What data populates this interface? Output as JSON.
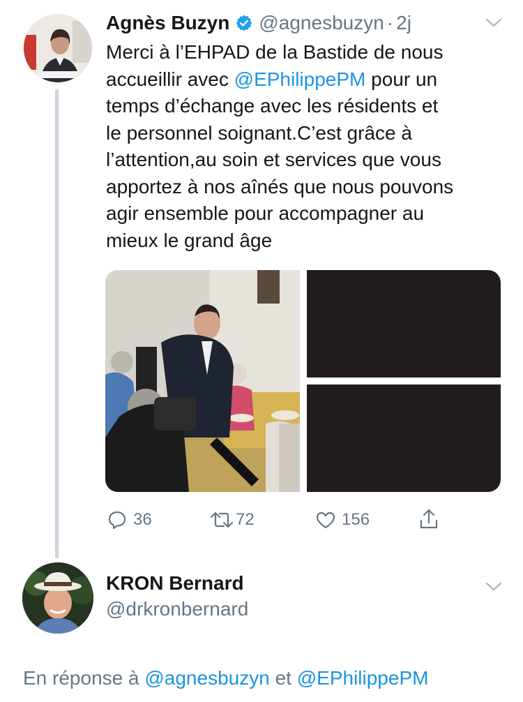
{
  "tweet": {
    "author_name": "Agnès Buzyn",
    "author_handle": "@agnesbuzyn",
    "separator": "·",
    "time": "2j",
    "text": {
      "l1": "Merci à l’EHPAD de la Bastide de nous",
      "l2_pre": "accueillir avec ",
      "l2_mention": "@EPhilippePM",
      "l2_post": " pour un",
      "l3": "temps d’échange avec les résidents et",
      "l4": "le personnel soignant.C’est grâce à",
      "l5": "l’attention,au soin et services que vous",
      "l6": "apportez à nos aînés que nous pouvons",
      "l7": "agir ensemble pour accompagner au",
      "l8": "mieux le grand âge"
    },
    "actions": {
      "replies": "36",
      "retweets": "72",
      "likes": "156"
    }
  },
  "reply": {
    "author_name": "KRON Bernard",
    "author_handle": "@drkronbernard",
    "replying_prefix": "En réponse à",
    "replying_handle_1": "@agnesbuzyn",
    "replying_and": "et",
    "replying_handle_2": "@EPhilippePM"
  },
  "colors": {
    "link": "#1b95e0",
    "secondary_text": "#657786",
    "verified": "#1da1f2",
    "thread_line": "#ccd6dd"
  },
  "icons": [
    "verified-badge-icon",
    "chevron-down-icon",
    "reply-icon",
    "retweet-icon",
    "like-icon",
    "share-icon"
  ]
}
